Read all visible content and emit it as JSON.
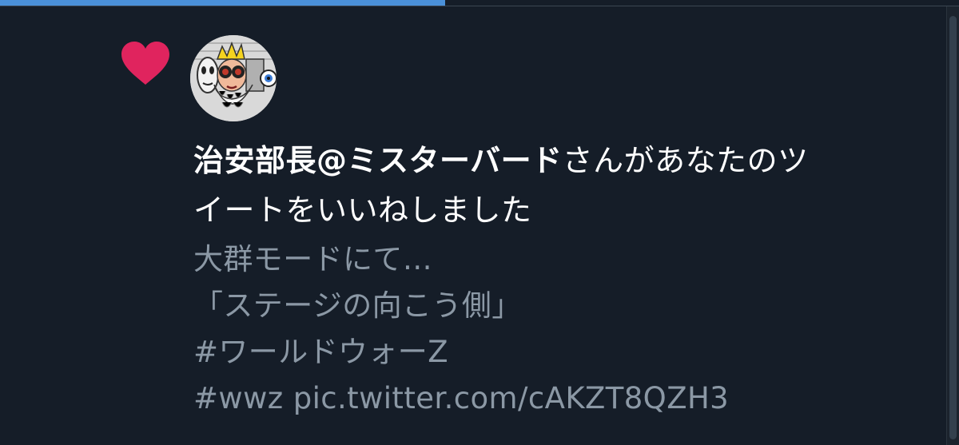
{
  "progress": {
    "fraction": 0.464
  },
  "notification": {
    "type": "like",
    "icon": "heart-icon",
    "avatar": "user-avatar",
    "user_name": "治安部長@ミスターバード",
    "action_text_1": "さんがあなたのツ",
    "action_text_2": "イートをいいねしました"
  },
  "tweet": {
    "lines": [
      "大群モードにて…",
      "「ステージの向こう側」",
      "#ワールドウォーZ",
      "#wwz pic.twitter.com/cAKZT8QZH3"
    ]
  },
  "colors": {
    "background": "#151d28",
    "heart": "#e0245e",
    "primary_text": "#ffffff",
    "secondary_text": "#8b98a5",
    "progress": "#4a90d9"
  }
}
